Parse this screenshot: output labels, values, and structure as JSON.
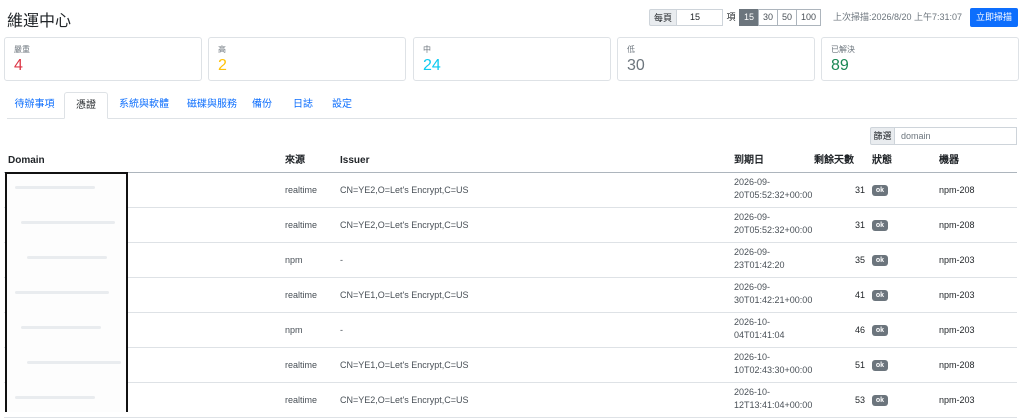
{
  "header": {
    "title": "維運中心",
    "per_page_label": "每頁",
    "per_page_value": "15",
    "per_page_unit": "項",
    "page_sizes": [
      "15",
      "30",
      "50",
      "100"
    ],
    "active_page_size": "15",
    "last_scan": "上次掃描:2026/8/20 上午7:31:07",
    "scan_button": "立即掃描"
  },
  "stats": [
    {
      "label": "嚴重",
      "value": "4",
      "color": "#dc3545"
    },
    {
      "label": "高",
      "value": "2",
      "color": "#ffc107"
    },
    {
      "label": "中",
      "value": "24",
      "color": "#0dcaf0"
    },
    {
      "label": "低",
      "value": "30",
      "color": "#6c757d"
    },
    {
      "label": "已解決",
      "value": "89",
      "color": "#198754"
    }
  ],
  "tabs": [
    {
      "label": "待辦事項"
    },
    {
      "label": "憑證",
      "active": true
    },
    {
      "label": "系統與軟體"
    },
    {
      "label": "磁碟與服務"
    },
    {
      "label": "備份"
    },
    {
      "label": "日誌"
    },
    {
      "label": "設定"
    }
  ],
  "filter": {
    "label": "篩選",
    "placeholder": "domain"
  },
  "table": {
    "columns": [
      "Domain",
      "來源",
      "Issuer",
      "到期日",
      "剩餘天數",
      "狀態",
      "機器"
    ],
    "rows": [
      {
        "source": "realtime",
        "issuer": "CN=YE2,O=Let's Encrypt,C=US",
        "expiry_date": "2026-09-",
        "expiry_time": "20T05:52:32+00:00",
        "days": "31",
        "status": "ok",
        "host": "npm-208"
      },
      {
        "source": "realtime",
        "issuer": "CN=YE2,O=Let's Encrypt,C=US",
        "expiry_date": "2026-09-",
        "expiry_time": "20T05:52:32+00:00",
        "days": "31",
        "status": "ok",
        "host": "npm-208"
      },
      {
        "source": "npm",
        "issuer": "-",
        "expiry_date": "2026-09-",
        "expiry_time": "23T01:42:20",
        "days": "35",
        "status": "ok",
        "host": "npm-203"
      },
      {
        "source": "realtime",
        "issuer": "CN=YE1,O=Let's Encrypt,C=US",
        "expiry_date": "2026-09-",
        "expiry_time": "30T01:42:21+00:00",
        "days": "41",
        "status": "ok",
        "host": "npm-203"
      },
      {
        "source": "npm",
        "issuer": "-",
        "expiry_date": "2026-10-",
        "expiry_time": "04T01:41:04",
        "days": "46",
        "status": "ok",
        "host": "npm-203"
      },
      {
        "source": "realtime",
        "issuer": "CN=YE1,O=Let's Encrypt,C=US",
        "expiry_date": "2026-10-",
        "expiry_time": "10T02:43:30+00:00",
        "days": "51",
        "status": "ok",
        "host": "npm-208"
      },
      {
        "source": "realtime",
        "issuer": "CN=YE2,O=Let's Encrypt,C=US",
        "expiry_date": "2026-10-",
        "expiry_time": "12T13:41:04+00:00",
        "days": "53",
        "status": "ok",
        "host": "npm-203"
      }
    ]
  }
}
